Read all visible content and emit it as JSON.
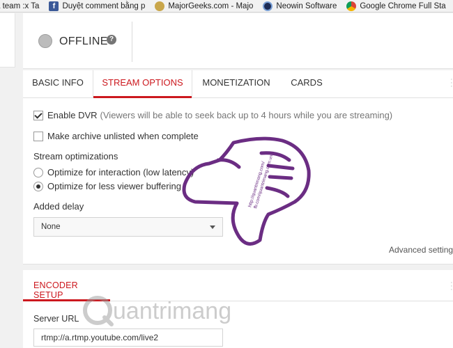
{
  "bookmarks": [
    {
      "label": "a team :x Ta",
      "icon": "tab-icon"
    },
    {
      "label": "Duyệt comment bằng p",
      "icon": "facebook-icon"
    },
    {
      "label": "MajorGeeks.com - Majo",
      "icon": "majorgeeks-icon"
    },
    {
      "label": "Neowin Software",
      "icon": "neowin-icon"
    },
    {
      "label": "Google Chrome Full Sta",
      "icon": "chrome-icon"
    }
  ],
  "status": {
    "text": "OFFLINE",
    "help_glyph": "?"
  },
  "tabs": [
    {
      "label": "BASIC INFO",
      "active": false
    },
    {
      "label": "STREAM OPTIONS",
      "active": true
    },
    {
      "label": "MONETIZATION",
      "active": false
    },
    {
      "label": "CARDS",
      "active": false
    }
  ],
  "stream_options": {
    "enable_dvr": {
      "label": "Enable DVR",
      "hint": "(Viewers will be able to seek back up to 4 hours while you are streaming)",
      "checked": true
    },
    "archive_unlisted": {
      "label": "Make archive unlisted when complete",
      "checked": false
    },
    "optimizations_label": "Stream optimizations",
    "optimizations": [
      {
        "label": "Optimize for interaction (low latency)",
        "checked": false
      },
      {
        "label": "Optimize for less viewer buffering",
        "checked": true
      }
    ],
    "delay_label": "Added delay",
    "delay_value": "None",
    "advanced_link": "Advanced settings"
  },
  "encoder": {
    "title": "ENCODER SETUP",
    "server_url_label": "Server URL",
    "server_url_value": "rtmp://a.rtmp.youtube.com/live2"
  },
  "overlay": {
    "thumb_color": "#6b2d83",
    "thumb_text_1": "http://quantrimang.com/",
    "thumb_text_2": "fb.com/quantrimang.com.vn",
    "watermark_text": "uantrimang"
  },
  "colors": {
    "accent": "#cc181e"
  }
}
